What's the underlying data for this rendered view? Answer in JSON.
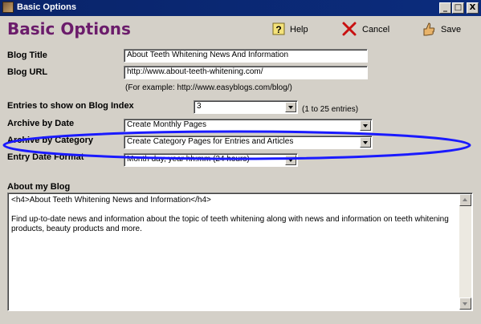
{
  "window": {
    "title": "Basic Options",
    "minimize": "_",
    "maximize": "□",
    "close": "X"
  },
  "header": {
    "heading": "Basic Options"
  },
  "toolbar": {
    "help_label": "Help",
    "cancel_label": "Cancel",
    "save_label": "Save"
  },
  "form": {
    "blog_title": {
      "label": "Blog Title",
      "value": "About Teeth Whitening News And Information"
    },
    "blog_url": {
      "label": "Blog URL",
      "value": "http://www.about-teeth-whitening.com/",
      "hint": "(For example: http://www.easyblogs.com/blog/)"
    },
    "entries": {
      "label": "Entries to show on Blog Index",
      "value": "3",
      "hint": "(1 to 25 entries)"
    },
    "archive_date": {
      "label": "Archive by Date",
      "value": "Create Monthly Pages"
    },
    "archive_category": {
      "label": "Archive by Category",
      "value": "Create Category Pages for Entries and Articles"
    },
    "entry_date_format": {
      "label": "Entry Date Format",
      "value": "Month day, year hh:mm (24 hours)"
    },
    "about": {
      "label": "About my Blog",
      "line1": "<h4>About Teeth Whitening News and Information</h4>",
      "line2": "Find up-to-date news and information about the topic of teeth whitening along with news and information on teeth whitening products, beauty products and more."
    }
  },
  "colors": {
    "title_bar": "#0a246a",
    "heading": "#6b1c6b",
    "highlight_ellipse": "#1a1aff",
    "face": "#d4d0c8"
  },
  "icons": [
    "help-icon",
    "cancel-icon",
    "save-icon",
    "app-icon"
  ]
}
